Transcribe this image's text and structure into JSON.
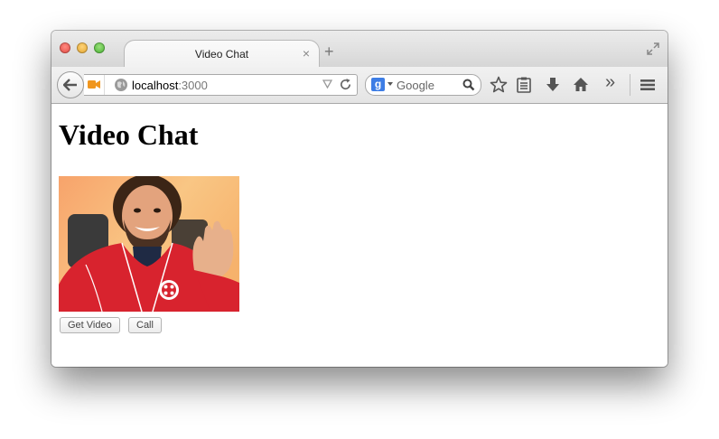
{
  "browser": {
    "tab_title": "Video Chat",
    "tab_close": "×",
    "new_tab": "+",
    "url_host": "localhost",
    "url_port": ":3000",
    "search_engine_letter": "g",
    "search_placeholder": "Google",
    "toolbar_icons": [
      "star-icon",
      "reading-list-icon",
      "download-icon",
      "home-icon",
      "overflow-chevron-icon",
      "menu-icon"
    ],
    "overflow_glyph": "»"
  },
  "page": {
    "title": "Video Chat",
    "get_video_label": "Get Video",
    "call_label": "Call"
  },
  "colors": {
    "camera_icon": "#f0961e",
    "search_engine": "#3d7de5",
    "jacket_red": "#d8232e"
  }
}
